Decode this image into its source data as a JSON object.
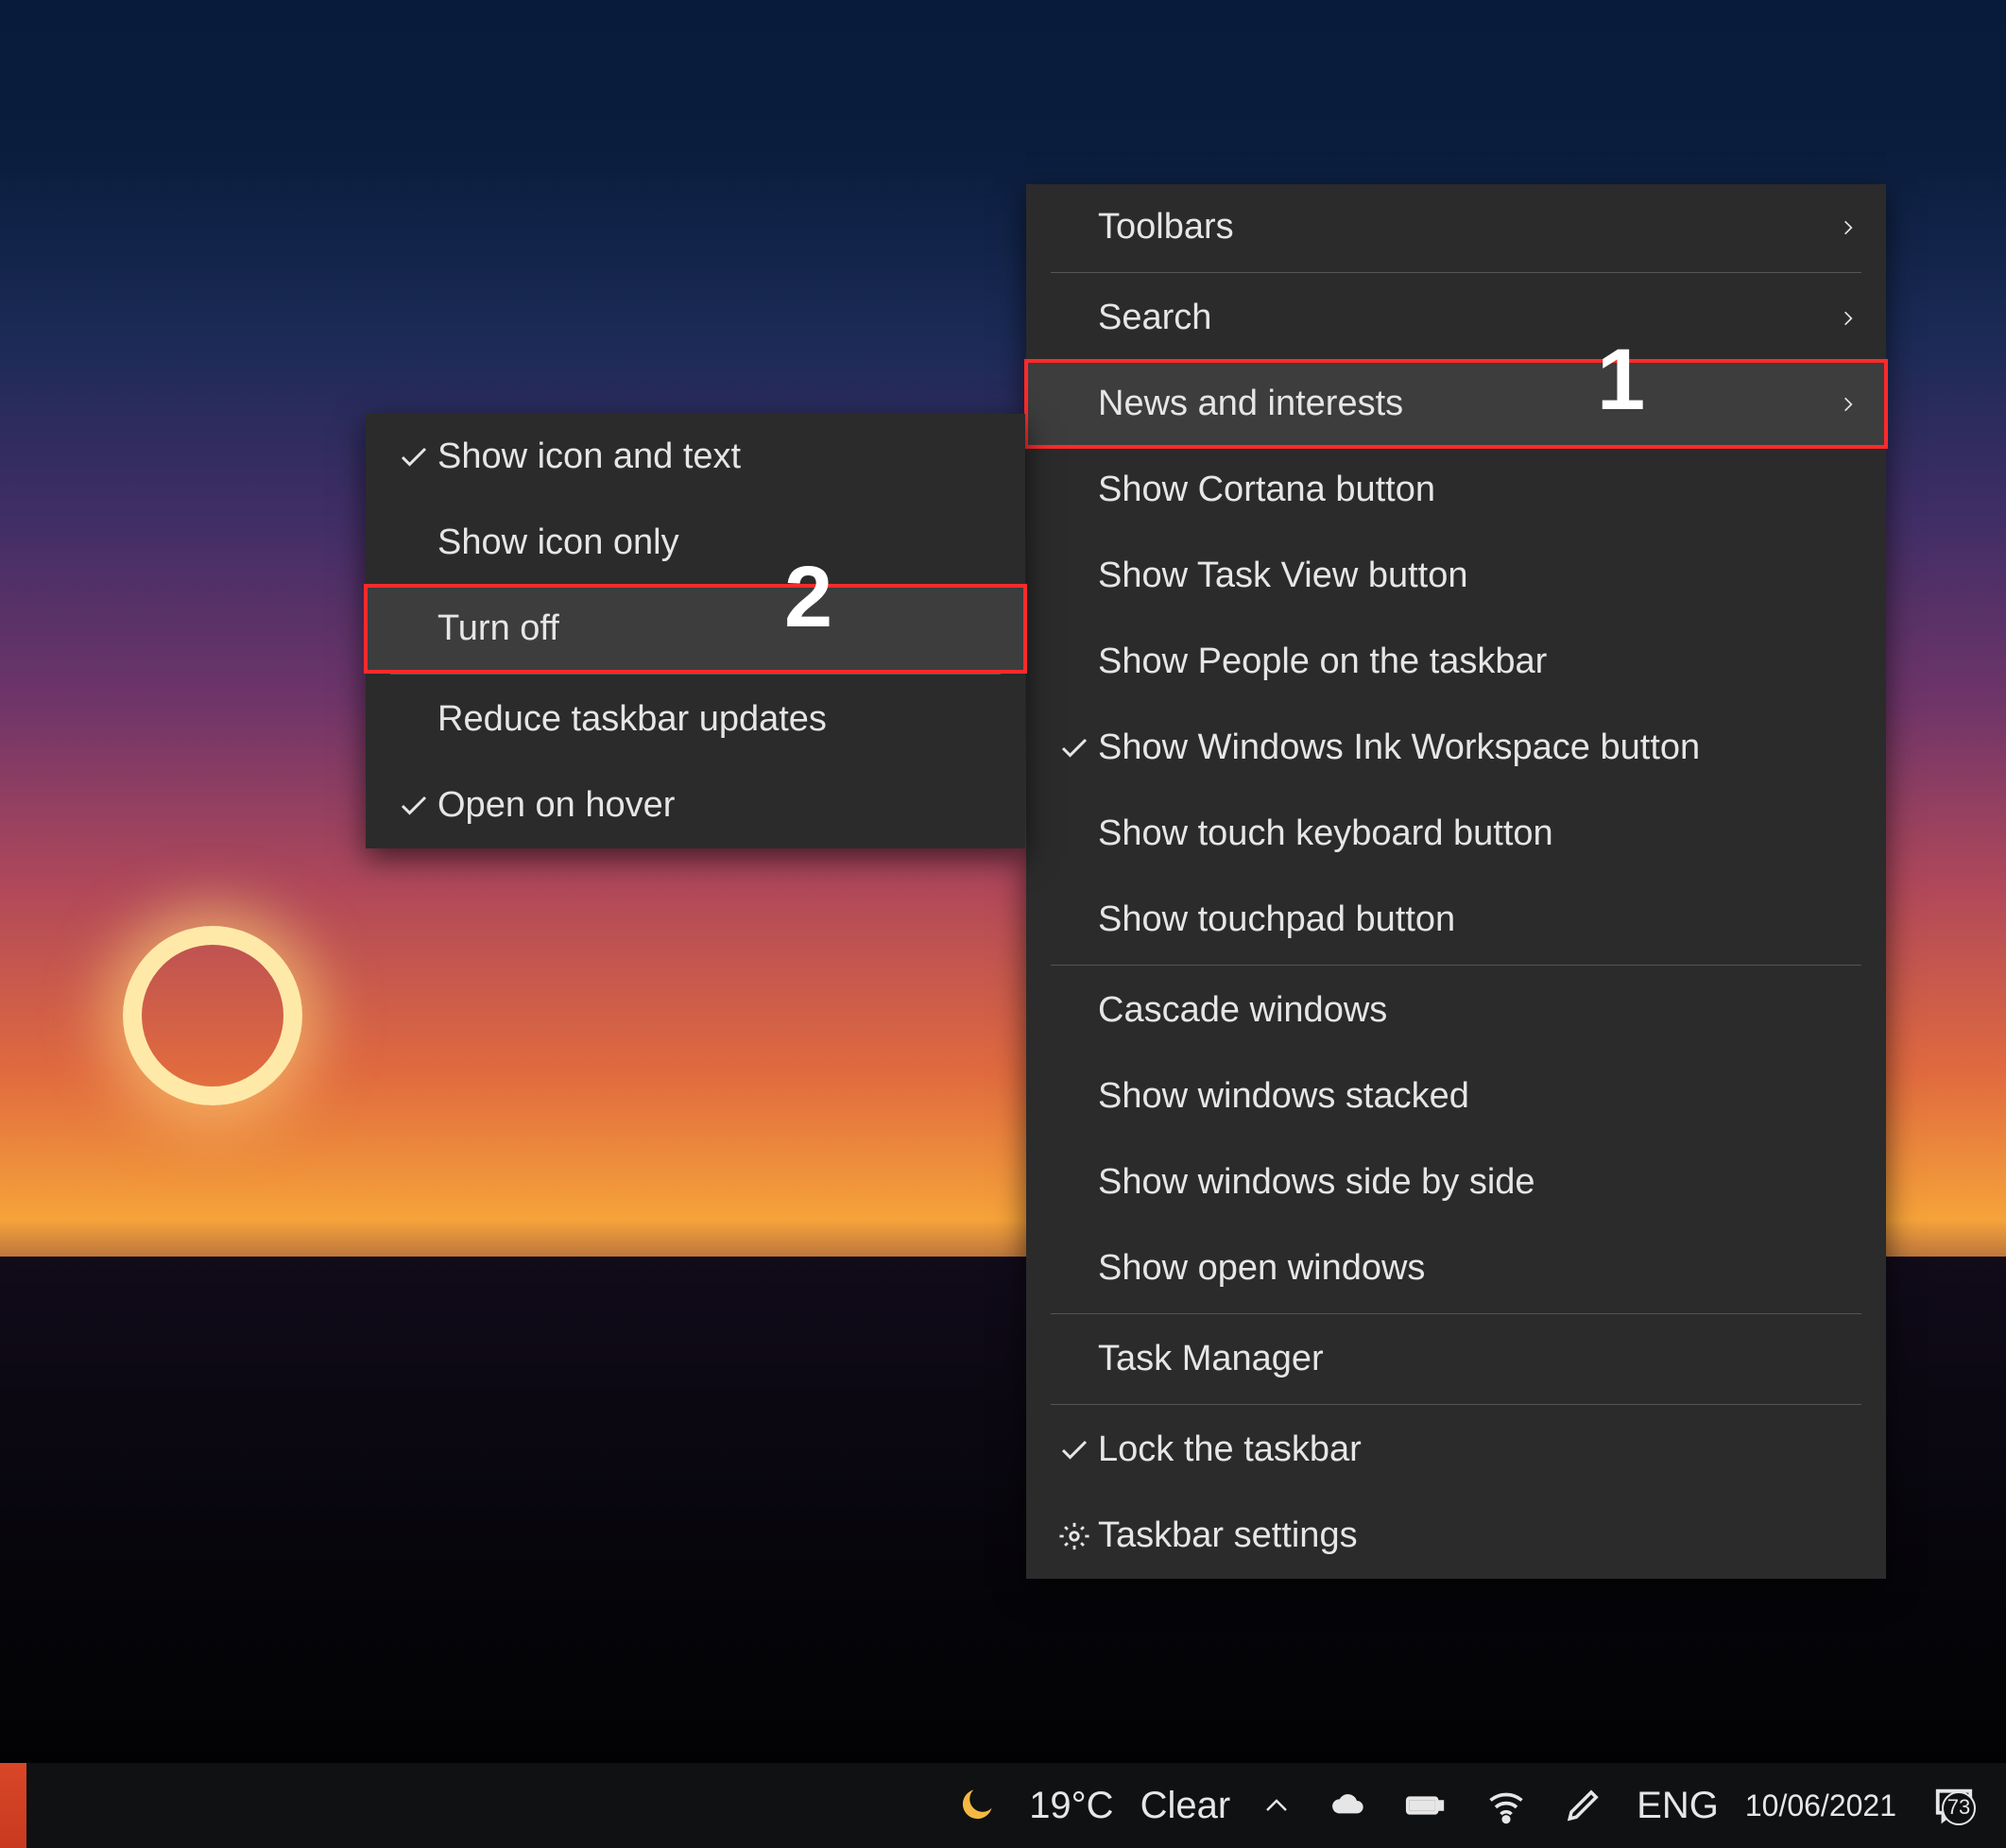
{
  "annotations": {
    "step1": "1",
    "step2": "2"
  },
  "main_menu": {
    "toolbars": "Toolbars",
    "search": "Search",
    "news_interests": "News and interests",
    "show_cortana": "Show Cortana button",
    "show_task_view": "Show Task View button",
    "show_people": "Show People on the taskbar",
    "show_ink": "Show Windows Ink Workspace button",
    "show_touch_kb": "Show touch keyboard button",
    "show_touchpad": "Show touchpad button",
    "cascade": "Cascade windows",
    "stacked": "Show windows stacked",
    "side_by_side": "Show windows side by side",
    "show_open": "Show open windows",
    "task_manager": "Task Manager",
    "lock_taskbar": "Lock the taskbar",
    "taskbar_settings": "Taskbar settings"
  },
  "sub_menu": {
    "show_icon_text": "Show icon and text",
    "show_icon_only": "Show icon only",
    "turn_off": "Turn off",
    "reduce_updates": "Reduce taskbar updates",
    "open_on_hover": "Open on hover"
  },
  "taskbar": {
    "temperature": "19°C",
    "condition": "Clear",
    "lang": "ENG",
    "date": "10/06/2021",
    "notif_count": "73"
  }
}
